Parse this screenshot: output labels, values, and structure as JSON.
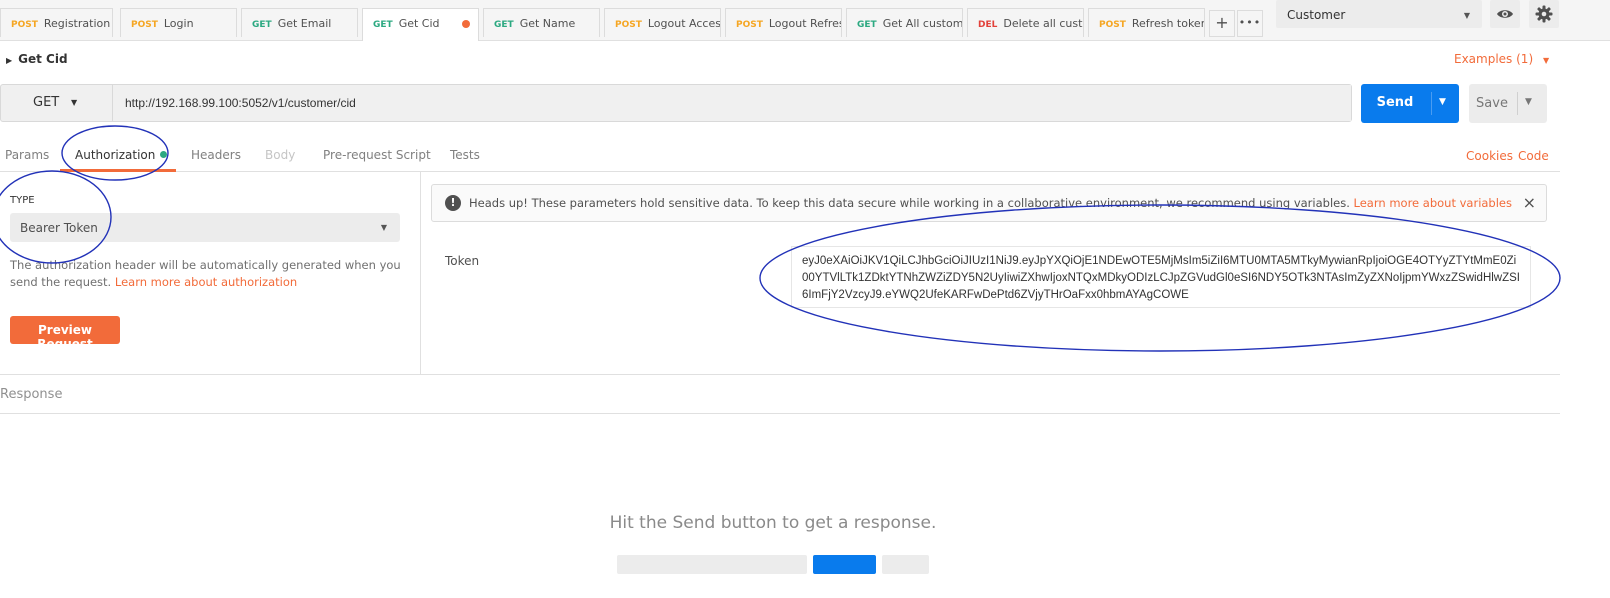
{
  "tabs": [
    {
      "method": "POST",
      "label": "Registration"
    },
    {
      "method": "POST",
      "label": "Login"
    },
    {
      "method": "GET",
      "label": "Get Email"
    },
    {
      "method": "GET",
      "label": "Get Cid"
    },
    {
      "method": "GET",
      "label": "Get Name"
    },
    {
      "method": "POST",
      "label": "Logout Access"
    },
    {
      "method": "POST",
      "label": "Logout Refresh"
    },
    {
      "method": "GET",
      "label": "Get All customers"
    },
    {
      "method": "DEL",
      "label": "Delete all customers"
    },
    {
      "method": "POST",
      "label": "Refresh token"
    }
  ],
  "tab_actions": {
    "add": "+",
    "more": "•••"
  },
  "environment": {
    "selected": "Customer"
  },
  "request": {
    "name": "Get Cid",
    "examples": "Examples (1)",
    "method": "GET",
    "url": "http://192.168.99.100:5052/v1/customer/cid",
    "send_label": "Send",
    "save_label": "Save"
  },
  "subtabs": {
    "params": "Params",
    "authorization": "Authorization",
    "headers": "Headers",
    "body": "Body",
    "prerequest": "Pre-request Script",
    "tests": "Tests",
    "cookies": "Cookies",
    "code": "Code"
  },
  "auth": {
    "type_label": "TYPE",
    "type_value": "Bearer Token",
    "description": "The authorization header will be automatically generated when you send the request.",
    "learn_more": "Learn more about authorization",
    "preview_button": "Preview Request"
  },
  "alert": {
    "icon": "!",
    "text": "Heads up! These parameters hold sensitive data. To keep this data secure while working in a collaborative environment, we recommend using variables.",
    "link": "Learn more about variables",
    "close": "×"
  },
  "token": {
    "label": "Token",
    "value": "eyJ0eXAiOiJKV1QiLCJhbGciOiJIUzI1NiJ9.eyJpYXQiOjE1NDEwOTE5MjMsIm5iZiI6MTU0MTA5MTkyMywianRpIjoiOGE4OTYyZTYtMmE0Zi00YTVlLTk1ZDktYTNhZWZiZDY5N2UyIiwiZXhwIjoxNTQxMDkyODIzLCJpZGVudGl0eSI6NDY5OTk3NTAsImZyZXNoIjpmYWxzZSwidHlwZSI6ImFjY2VzcyJ9.eYWQ2UfeKARFwDePtd6ZVjyTHrOaFxx0hbmAYAgCOWE"
  },
  "response": {
    "title": "Response",
    "hint": "Hit the Send button to get a response."
  },
  "colors": {
    "accent": "#f26b3a",
    "send": "#097bed",
    "post": "#f5a623",
    "get": "#2ca981",
    "del": "#e2413a",
    "annotation": "#2232b8"
  }
}
